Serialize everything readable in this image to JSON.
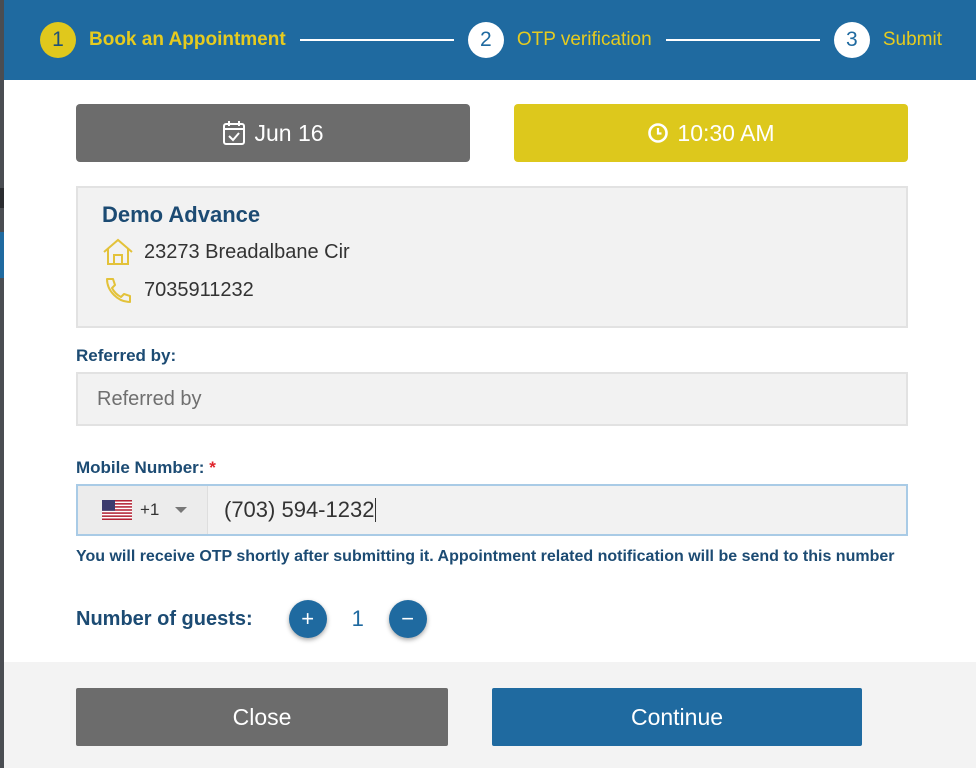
{
  "stepper": {
    "steps": [
      {
        "number": "1",
        "label": "Book an Appointment",
        "active": true
      },
      {
        "number": "2",
        "label": "OTP verification",
        "active": false
      },
      {
        "number": "3",
        "label": "Submit",
        "active": false
      }
    ]
  },
  "appointment": {
    "date_label": "Jun 16",
    "time_label": "10:30 AM"
  },
  "shop": {
    "name": "Demo Advance",
    "address": "23273 Breadalbane Cir",
    "phone": "7035911232"
  },
  "referred": {
    "label": "Referred by:",
    "placeholder": "Referred by"
  },
  "mobile": {
    "label": "Mobile Number:",
    "required_mark": "*",
    "country_code": "+1",
    "country_flag": "us-flag",
    "value": "(703) 594-1232",
    "note": "You will receive OTP shortly after submitting it. Appointment related notification will be send to this number"
  },
  "guests": {
    "label": "Number of guests:",
    "count": "1",
    "plus": "+",
    "minus": "−"
  },
  "footer": {
    "close_label": "Close",
    "continue_label": "Continue"
  },
  "colors": {
    "primary": "#1f6aa0",
    "accent": "#ddc81c",
    "neutral": "#6c6c6c",
    "text_dark": "#1c4b73"
  }
}
